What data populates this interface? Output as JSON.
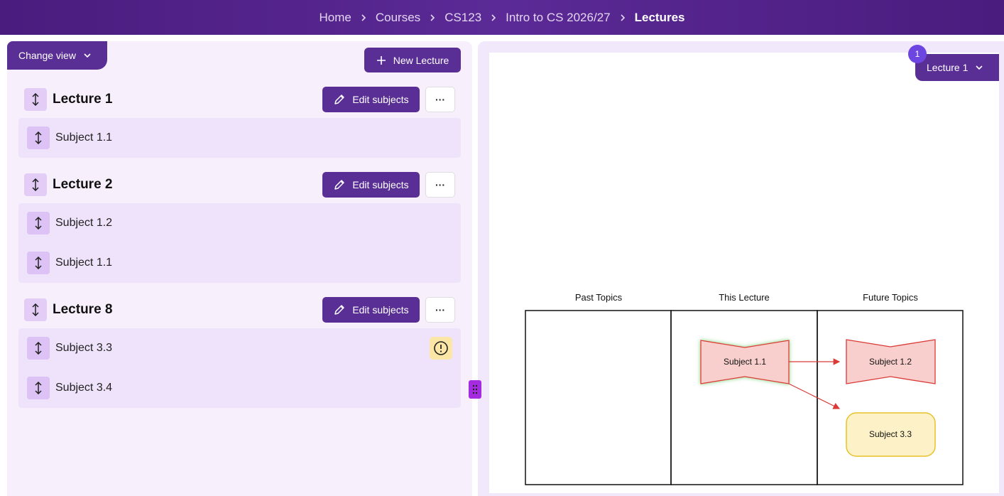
{
  "breadcrumb": [
    "Home",
    "Courses",
    "CS123",
    "Intro to CS 2026/27",
    "Lectures"
  ],
  "left": {
    "change_view_label": "Change view",
    "new_lecture_label": "New Lecture",
    "lectures": [
      {
        "title": "Lecture 1",
        "edit_label": "Edit subjects",
        "more_label": "···",
        "subjects": [
          {
            "label": "Subject 1.1"
          }
        ]
      },
      {
        "title": "Lecture 2",
        "edit_label": "Edit subjects",
        "more_label": "···",
        "subjects": [
          {
            "label": "Subject 1.2"
          },
          {
            "label": "Subject 1.1"
          }
        ]
      },
      {
        "title": "Lecture 8",
        "edit_label": "Edit subjects",
        "more_label": "···",
        "subjects": [
          {
            "label": "Subject 3.3",
            "warning": true
          },
          {
            "label": "Subject 3.4"
          }
        ]
      }
    ]
  },
  "right": {
    "lecture_select_label": "Lecture 1",
    "badge_count": "1",
    "diagram": {
      "columns": [
        "Past Topics",
        "This Lecture",
        "Future Topics"
      ],
      "nodes": {
        "current": "Subject 1.1",
        "future_1": "Subject 1.2",
        "future_2": "Subject 3.3"
      }
    }
  },
  "colors": {
    "header": "#4a1c7e",
    "primary": "#5a2f95",
    "handle": "#e3cdf7",
    "panel": "#f7f0fc",
    "node_red_fill": "#f8cfcc",
    "node_red_stroke": "#d93a36",
    "node_yellow_fill": "#fdf1c7",
    "node_yellow_stroke": "#e6c229",
    "badge": "#6d45e0"
  }
}
